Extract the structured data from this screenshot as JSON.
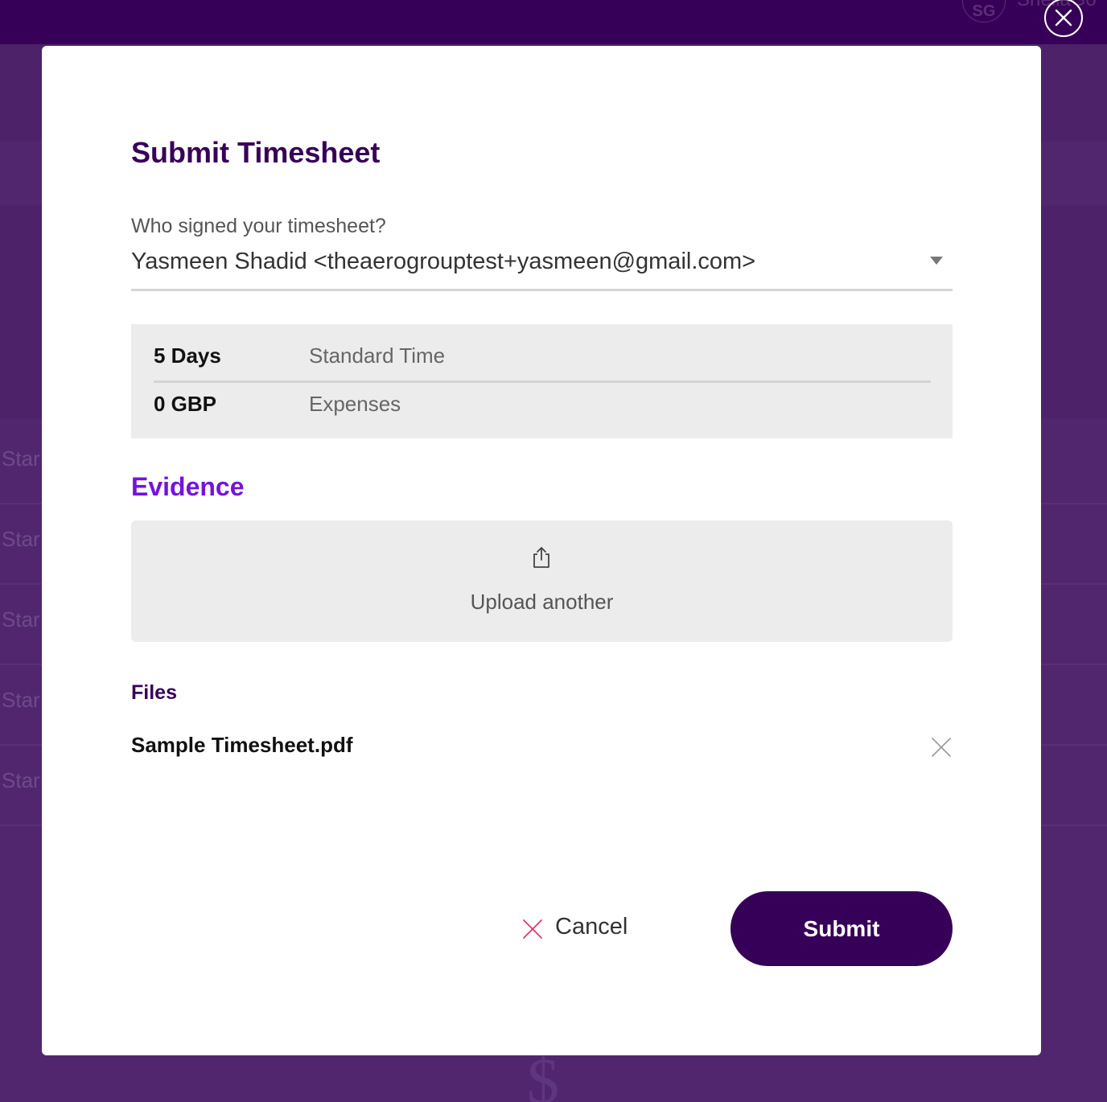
{
  "background": {
    "user_initials": "SG",
    "user_name": "ShellaGo",
    "rows": [
      "Star",
      "Star",
      "Star",
      "Star",
      "Star"
    ]
  },
  "modal": {
    "close_icon": "close-circle-icon",
    "title": "Submit Timesheet",
    "signer": {
      "label": "Who signed your timesheet?",
      "selected": "Yasmeen Shadid <theaerogrouptest+yasmeen@gmail.com>"
    },
    "summary": [
      {
        "value": "5 Days",
        "label": "Standard Time"
      },
      {
        "value": "0 GBP",
        "label": "Expenses"
      }
    ],
    "evidence": {
      "title": "Evidence",
      "upload_icon": "upload-icon",
      "upload_label": "Upload another"
    },
    "files": {
      "title": "Files",
      "items": [
        {
          "name": "Sample Timesheet.pdf",
          "remove_icon": "close-icon"
        }
      ]
    },
    "actions": {
      "cancel_label": "Cancel",
      "submit_label": "Submit"
    }
  },
  "colors": {
    "brand_dark": "#370058",
    "accent_purple": "#7413dc",
    "cancel_icon": "#e0386d"
  }
}
